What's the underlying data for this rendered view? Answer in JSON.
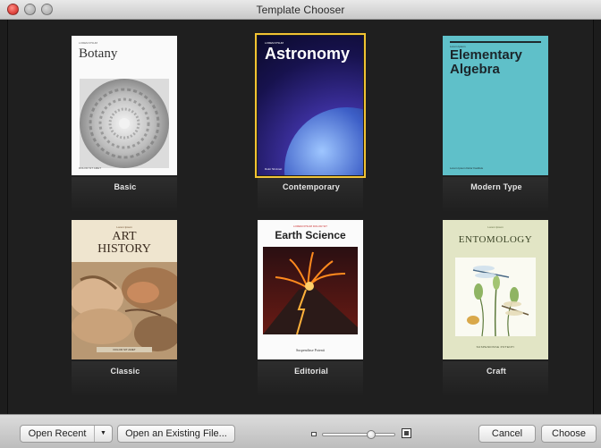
{
  "window": {
    "title": "Template Chooser"
  },
  "templates": [
    {
      "name": "Basic",
      "cover": {
        "small": "LOREM IPSUM",
        "title": "Botany",
        "footer": "DOLOR SIT AMET"
      }
    },
    {
      "name": "Contemporary",
      "selected": true,
      "cover": {
        "small": "LOREM IPSUM",
        "title": "Astronomy",
        "footer": "Dolor Sit Amet"
      }
    },
    {
      "name": "Modern Type",
      "cover": {
        "small": "Lorem Ipsum",
        "title_line1": "Elementary",
        "title_line2": "Algebra",
        "footer": "Lorem Ipsum Dolor Facilisis"
      }
    },
    {
      "name": "Classic",
      "cover": {
        "small": "Lorem Ipsum",
        "title_line1": "ART",
        "title_line2": "HISTORY",
        "footer": "DOLOR SIT AMET"
      }
    },
    {
      "name": "Editorial",
      "cover": {
        "small": "LOREM IPSUM DOLOR SIT",
        "title": "Earth Science",
        "footer": "Suspendisse Potenti"
      }
    },
    {
      "name": "Craft",
      "cover": {
        "small": "Lorem Ipsum",
        "title": "ENTOMOLOGY",
        "footer": "SUSPENDISSE POTENTI"
      }
    }
  ],
  "toolbar": {
    "open_recent": "Open Recent",
    "open_existing": "Open an Existing File...",
    "cancel": "Cancel",
    "choose": "Choose",
    "zoom_level": 0.7
  },
  "colors": {
    "selection": "#f1c232"
  }
}
